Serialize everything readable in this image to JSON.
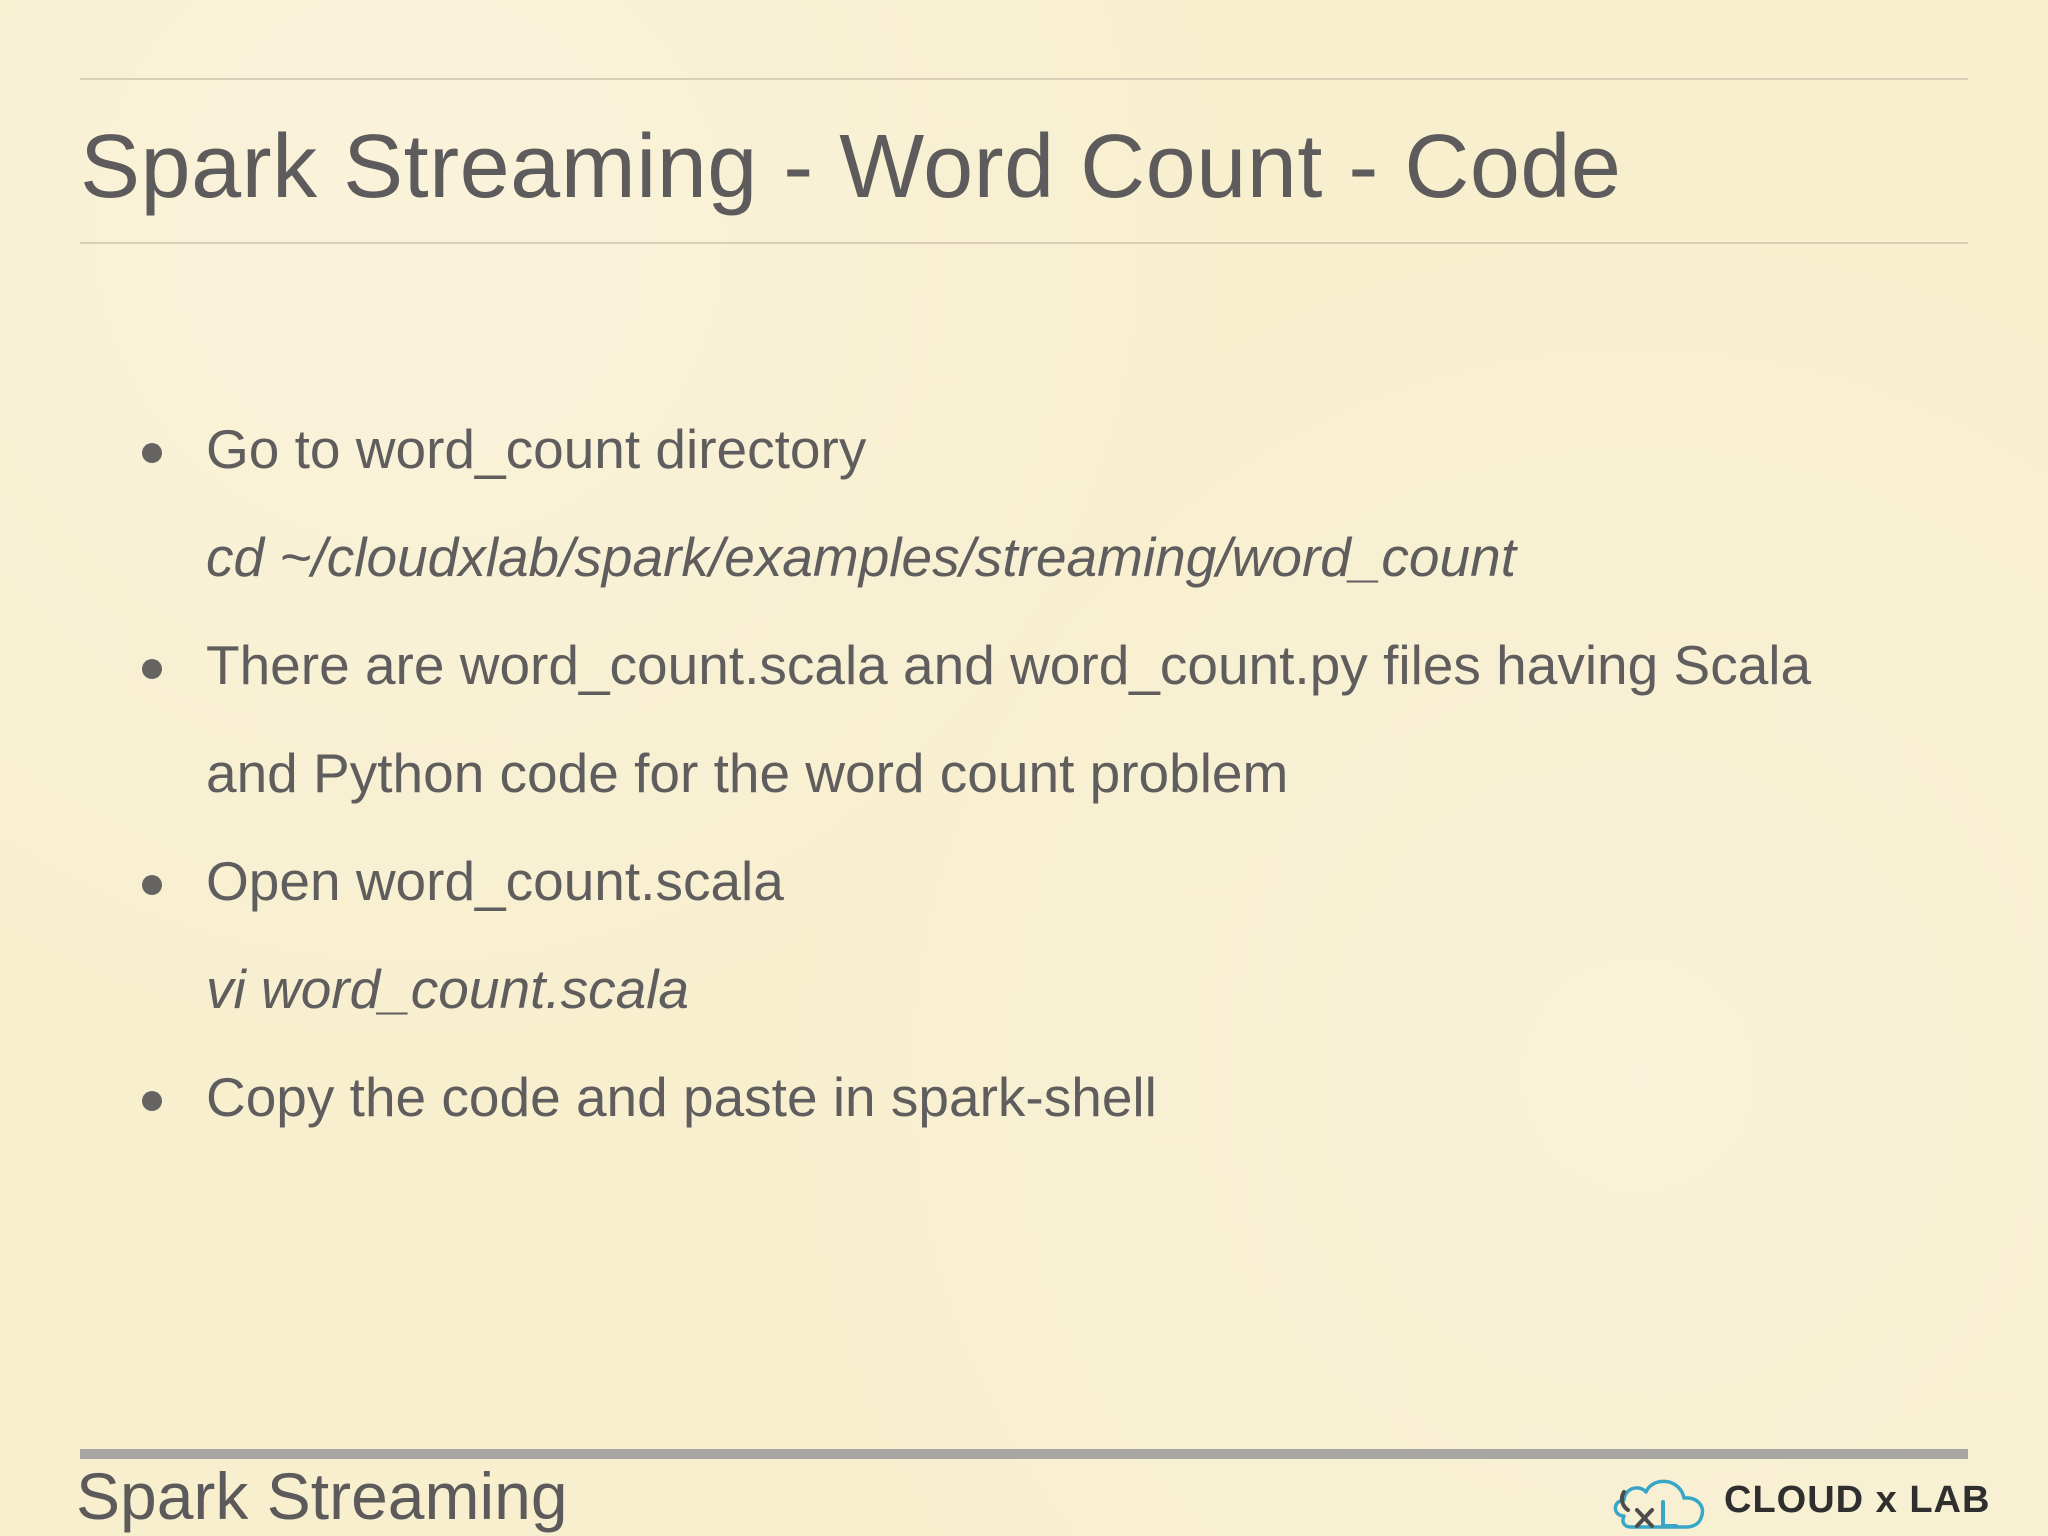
{
  "slide": {
    "title": "Spark Streaming - Word Count - Code",
    "items": [
      {
        "text": "Go to word_count directory",
        "code": "cd ~/cloudxlab/spark/examples/streaming/word_count"
      },
      {
        "text_line1": "There are word_count.scala and word_count.py files having Scala",
        "text_line2": "and Python code for the word count problem"
      },
      {
        "text": "Open word_count.scala",
        "code": "vi word_count.scala"
      },
      {
        "text": "Copy the code and paste in spark-shell"
      }
    ],
    "footer_title": "Spark Streaming",
    "logo_text": "CLOUD x LAB"
  },
  "colors": {
    "background": "#f8efcf",
    "text": "#5f5d5d",
    "rule": "#d8cfb6",
    "footer_rule": "#a8a6a2",
    "logo_accent": "#39a6c8"
  },
  "icons": {
    "bullet": "bullet-dot",
    "logo": "cloudxlab-cloud-logo"
  }
}
